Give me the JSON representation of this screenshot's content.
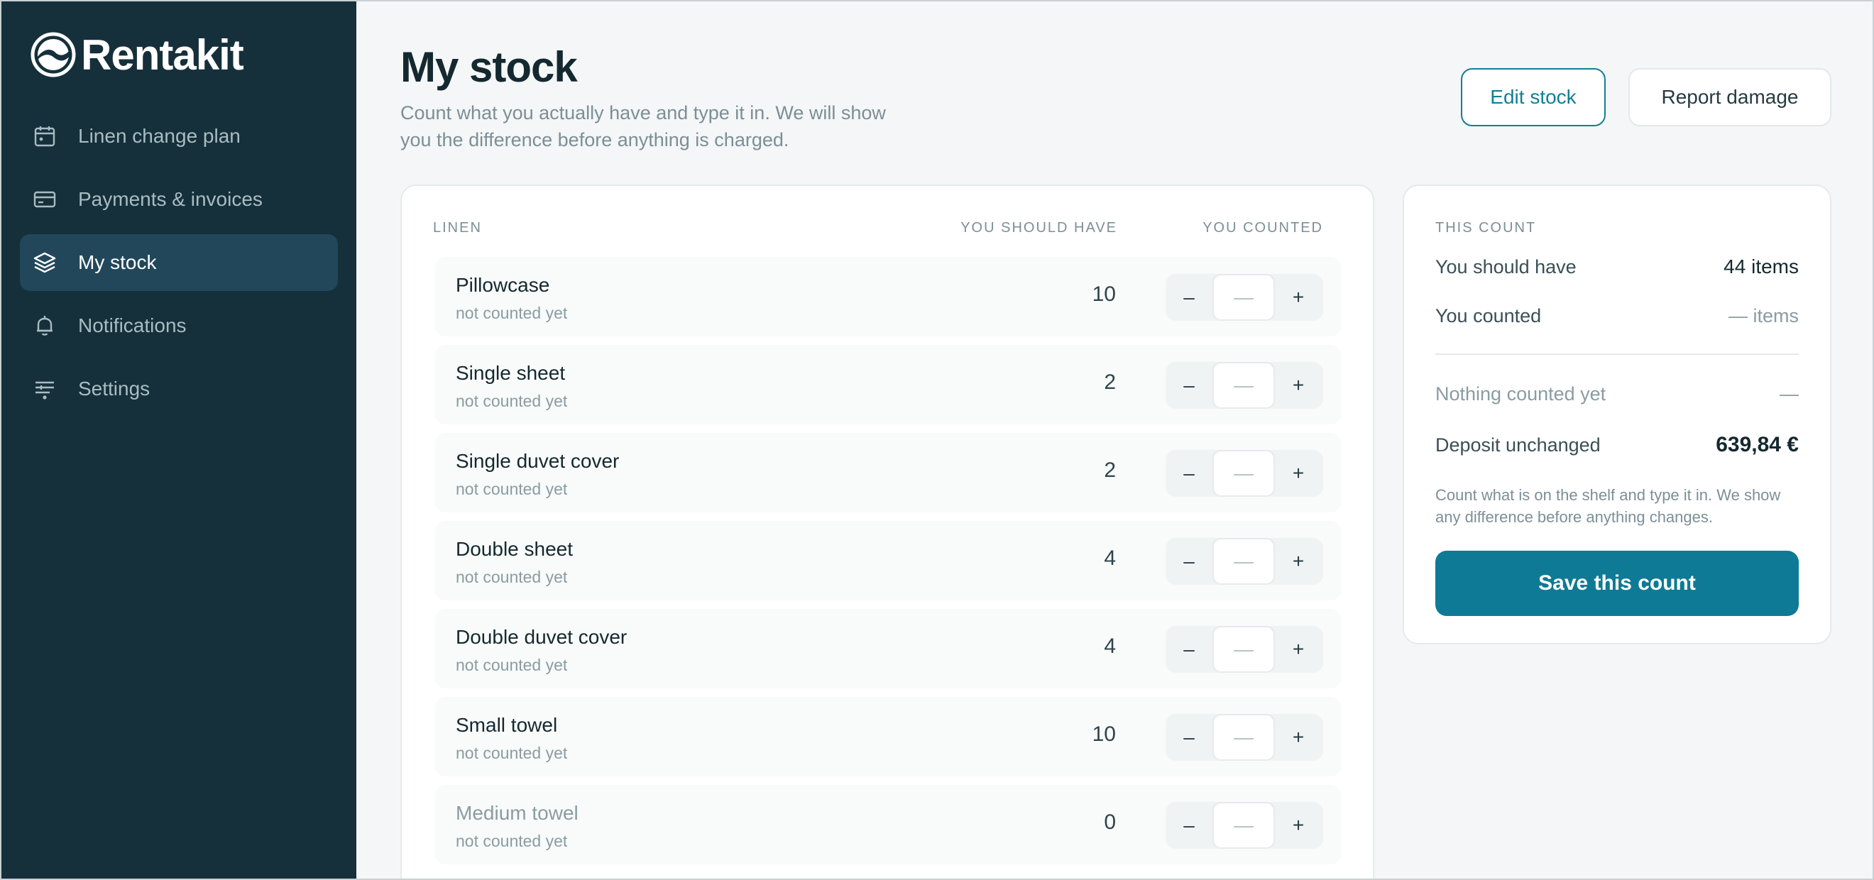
{
  "brand": {
    "name": "Rentakit"
  },
  "nav": {
    "items": [
      {
        "label": "Linen change plan",
        "icon": "calendar-icon",
        "active": false
      },
      {
        "label": "Payments & invoices",
        "icon": "credit-card-icon",
        "active": false
      },
      {
        "label": "My stock",
        "icon": "layers-icon",
        "active": true
      },
      {
        "label": "Notifications",
        "icon": "bell-icon",
        "active": false
      },
      {
        "label": "Settings",
        "icon": "sliders-icon",
        "active": false
      }
    ]
  },
  "header": {
    "title": "My stock",
    "subtitle": "Count what you actually have and type it in. We will show you the difference before anything is charged.",
    "edit_label": "Edit stock",
    "report_label": "Report damage"
  },
  "table": {
    "columns": {
      "linen": "LINEN",
      "should": "YOU SHOULD HAVE",
      "counted": "YOU COUNTED"
    },
    "minus_label": "–",
    "plus_label": "+",
    "rows": [
      {
        "name": "Pillowcase",
        "status": "not counted yet",
        "should": "10",
        "counted": "—"
      },
      {
        "name": "Single sheet",
        "status": "not counted yet",
        "should": "2",
        "counted": "—"
      },
      {
        "name": "Single duvet cover",
        "status": "not counted yet",
        "should": "2",
        "counted": "—"
      },
      {
        "name": "Double sheet",
        "status": "not counted yet",
        "should": "4",
        "counted": "—"
      },
      {
        "name": "Double duvet cover",
        "status": "not counted yet",
        "should": "4",
        "counted": "—"
      },
      {
        "name": "Small towel",
        "status": "not counted yet",
        "should": "10",
        "counted": "—"
      },
      {
        "name": "Medium towel",
        "status": "not counted yet",
        "should": "0",
        "counted": "—"
      }
    ]
  },
  "summary": {
    "heading": "THIS COUNT",
    "should_label": "You should have",
    "should_value": "44 items",
    "counted_label": "You counted",
    "counted_value": "— items",
    "diff_label": "Nothing counted yet",
    "diff_value": "—",
    "deposit_label": "Deposit unchanged",
    "deposit_value": "639,84 €",
    "note": "Count what is on the shelf and type it in. We show any difference before anything changes.",
    "save_label": "Save this count"
  },
  "colors": {
    "sidebar": "#15303a",
    "active_nav": "#22475a",
    "accent": "#0f7a95"
  }
}
